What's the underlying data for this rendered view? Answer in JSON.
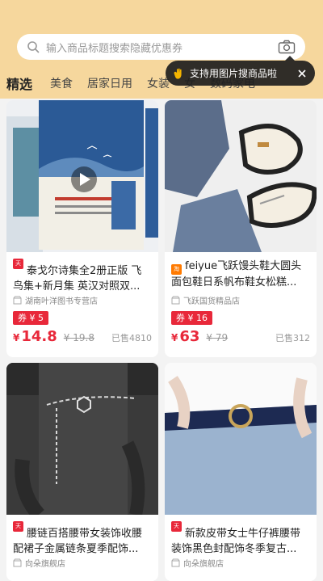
{
  "search": {
    "placeholder": "输入商品标题搜索隐藏优惠券"
  },
  "tabs": [
    "精选",
    "美食",
    "居家日用",
    "女装",
    "女",
    "数码家电"
  ],
  "tooltip": {
    "text": "支持用图片搜商品啦"
  },
  "products": [
    {
      "badge": "天猫",
      "title": "泰戈尔诗集全2册正版 飞鸟集+新月集 英汉对照双...",
      "shop": "湖南叶洋图书专营店",
      "coupon": "券 ¥ 5",
      "price_symbol": "¥",
      "price": "14.8",
      "original": "¥ 19.8",
      "sold": "已售4810"
    },
    {
      "badge": "淘",
      "title": "feiyue飞跃馒头鞋大圆头面包鞋日系帆布鞋女松糕...",
      "shop": "飞跃国货精品店",
      "coupon": "券 ¥ 16",
      "price_symbol": "¥",
      "price": "63",
      "original": "¥ 79",
      "sold": "已售312"
    },
    {
      "badge": "天猫",
      "title": "腰链百搭腰带女装饰收腰配裙子金属链条夏季配饰...",
      "shop": "向朵旗舰店"
    },
    {
      "badge": "天猫",
      "title": "新款皮带女士牛仔裤腰带装饰黑色封配饰冬季复古...",
      "shop": "向朵旗舰店"
    }
  ],
  "colors": {
    "header": "#f6d79d",
    "price_red": "#e8283a",
    "tmall_badge": "#e8283a",
    "taobao_badge": "#ff7a00"
  },
  "icons": [
    "search-icon",
    "camera-icon",
    "hand-wave-icon",
    "close-icon",
    "play-icon",
    "shop-icon"
  ]
}
